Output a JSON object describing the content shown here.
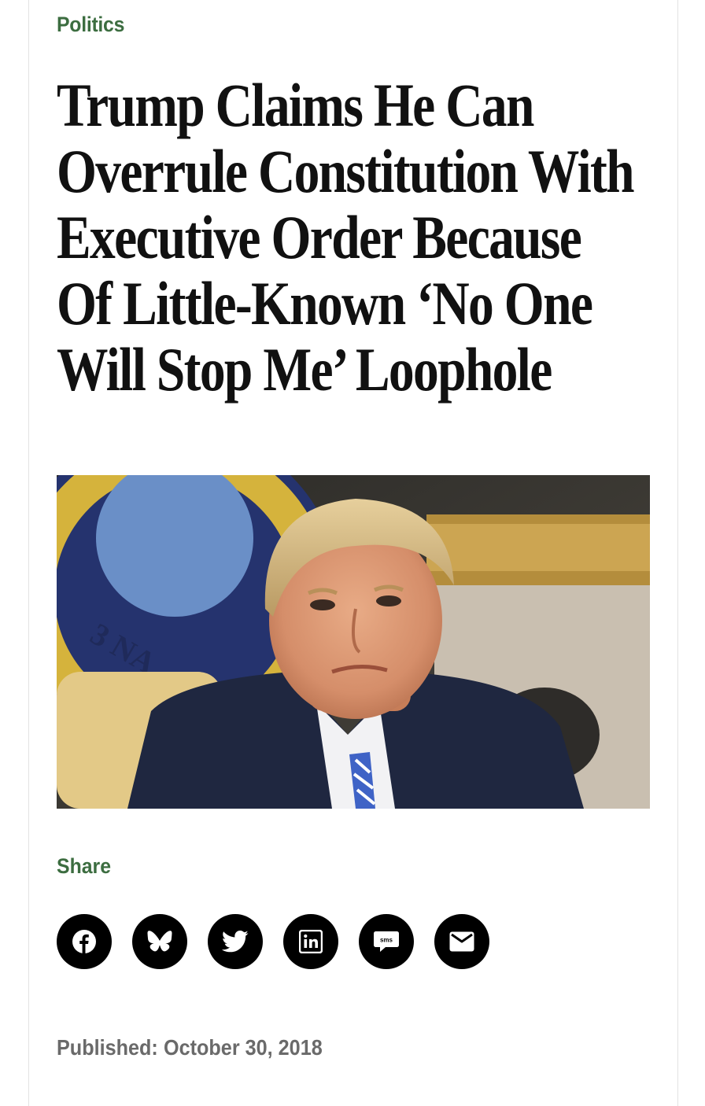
{
  "article": {
    "section": "Politics",
    "headline": "Trump Claims He Can Overrule Constitution With Executive Order Because Of Little-Known ‘No One Will Stop Me’ Loophole",
    "image": {
      "subject": "photo-of-man-in-suit-with-blue-striped-tie"
    },
    "share": {
      "label": "Share",
      "buttons": [
        {
          "icon": "facebook-icon",
          "label": "Facebook"
        },
        {
          "icon": "bluesky-icon",
          "label": "Bluesky"
        },
        {
          "icon": "twitter-icon",
          "label": "Twitter"
        },
        {
          "icon": "linkedin-icon",
          "label": "LinkedIn"
        },
        {
          "icon": "sms-icon",
          "label": "SMS",
          "glyph_text": "sms"
        },
        {
          "icon": "email-icon",
          "label": "Email"
        }
      ]
    },
    "published": {
      "label": "Published:",
      "date": "October 30, 2018"
    }
  },
  "colors": {
    "accent": "#3c6d40",
    "headline": "#111111",
    "meta": "#6a6a6a",
    "share_button": "#000000"
  }
}
